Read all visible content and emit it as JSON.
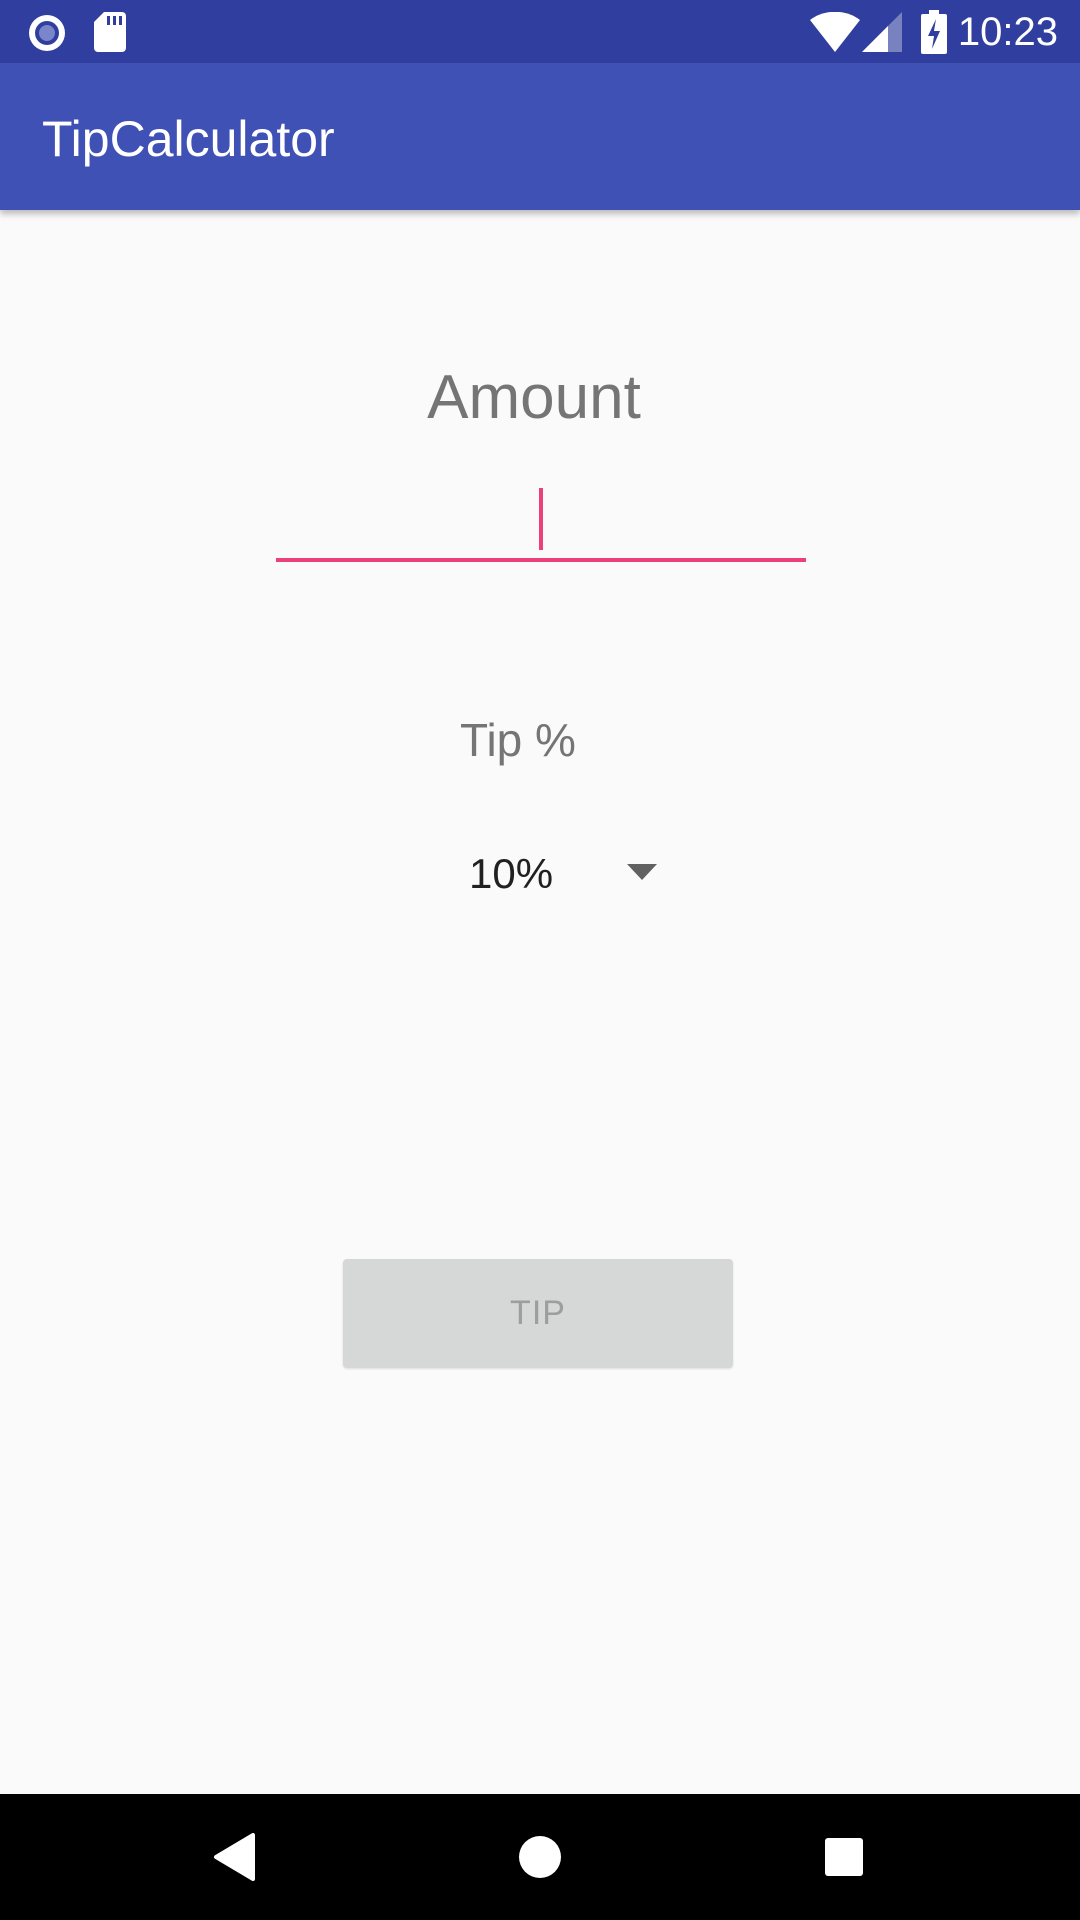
{
  "status_bar": {
    "time": "10:23",
    "icons": [
      "camera-notification-icon",
      "sd-card-icon",
      "wifi-icon",
      "cell-signal-icon",
      "battery-charging-icon"
    ],
    "background": "#303f9f"
  },
  "app_bar": {
    "title": "TipCalculator",
    "background": "#3f51b5"
  },
  "form": {
    "amount_label": "Amount",
    "amount_value": "",
    "accent_color": "#e91e63",
    "tip_label": "Tip %",
    "tip_selected": "10%",
    "tip_button_label": "TIP",
    "tip_button_enabled": false
  },
  "nav_bar": {
    "icons": [
      "back-icon",
      "home-icon",
      "recents-icon"
    ]
  }
}
